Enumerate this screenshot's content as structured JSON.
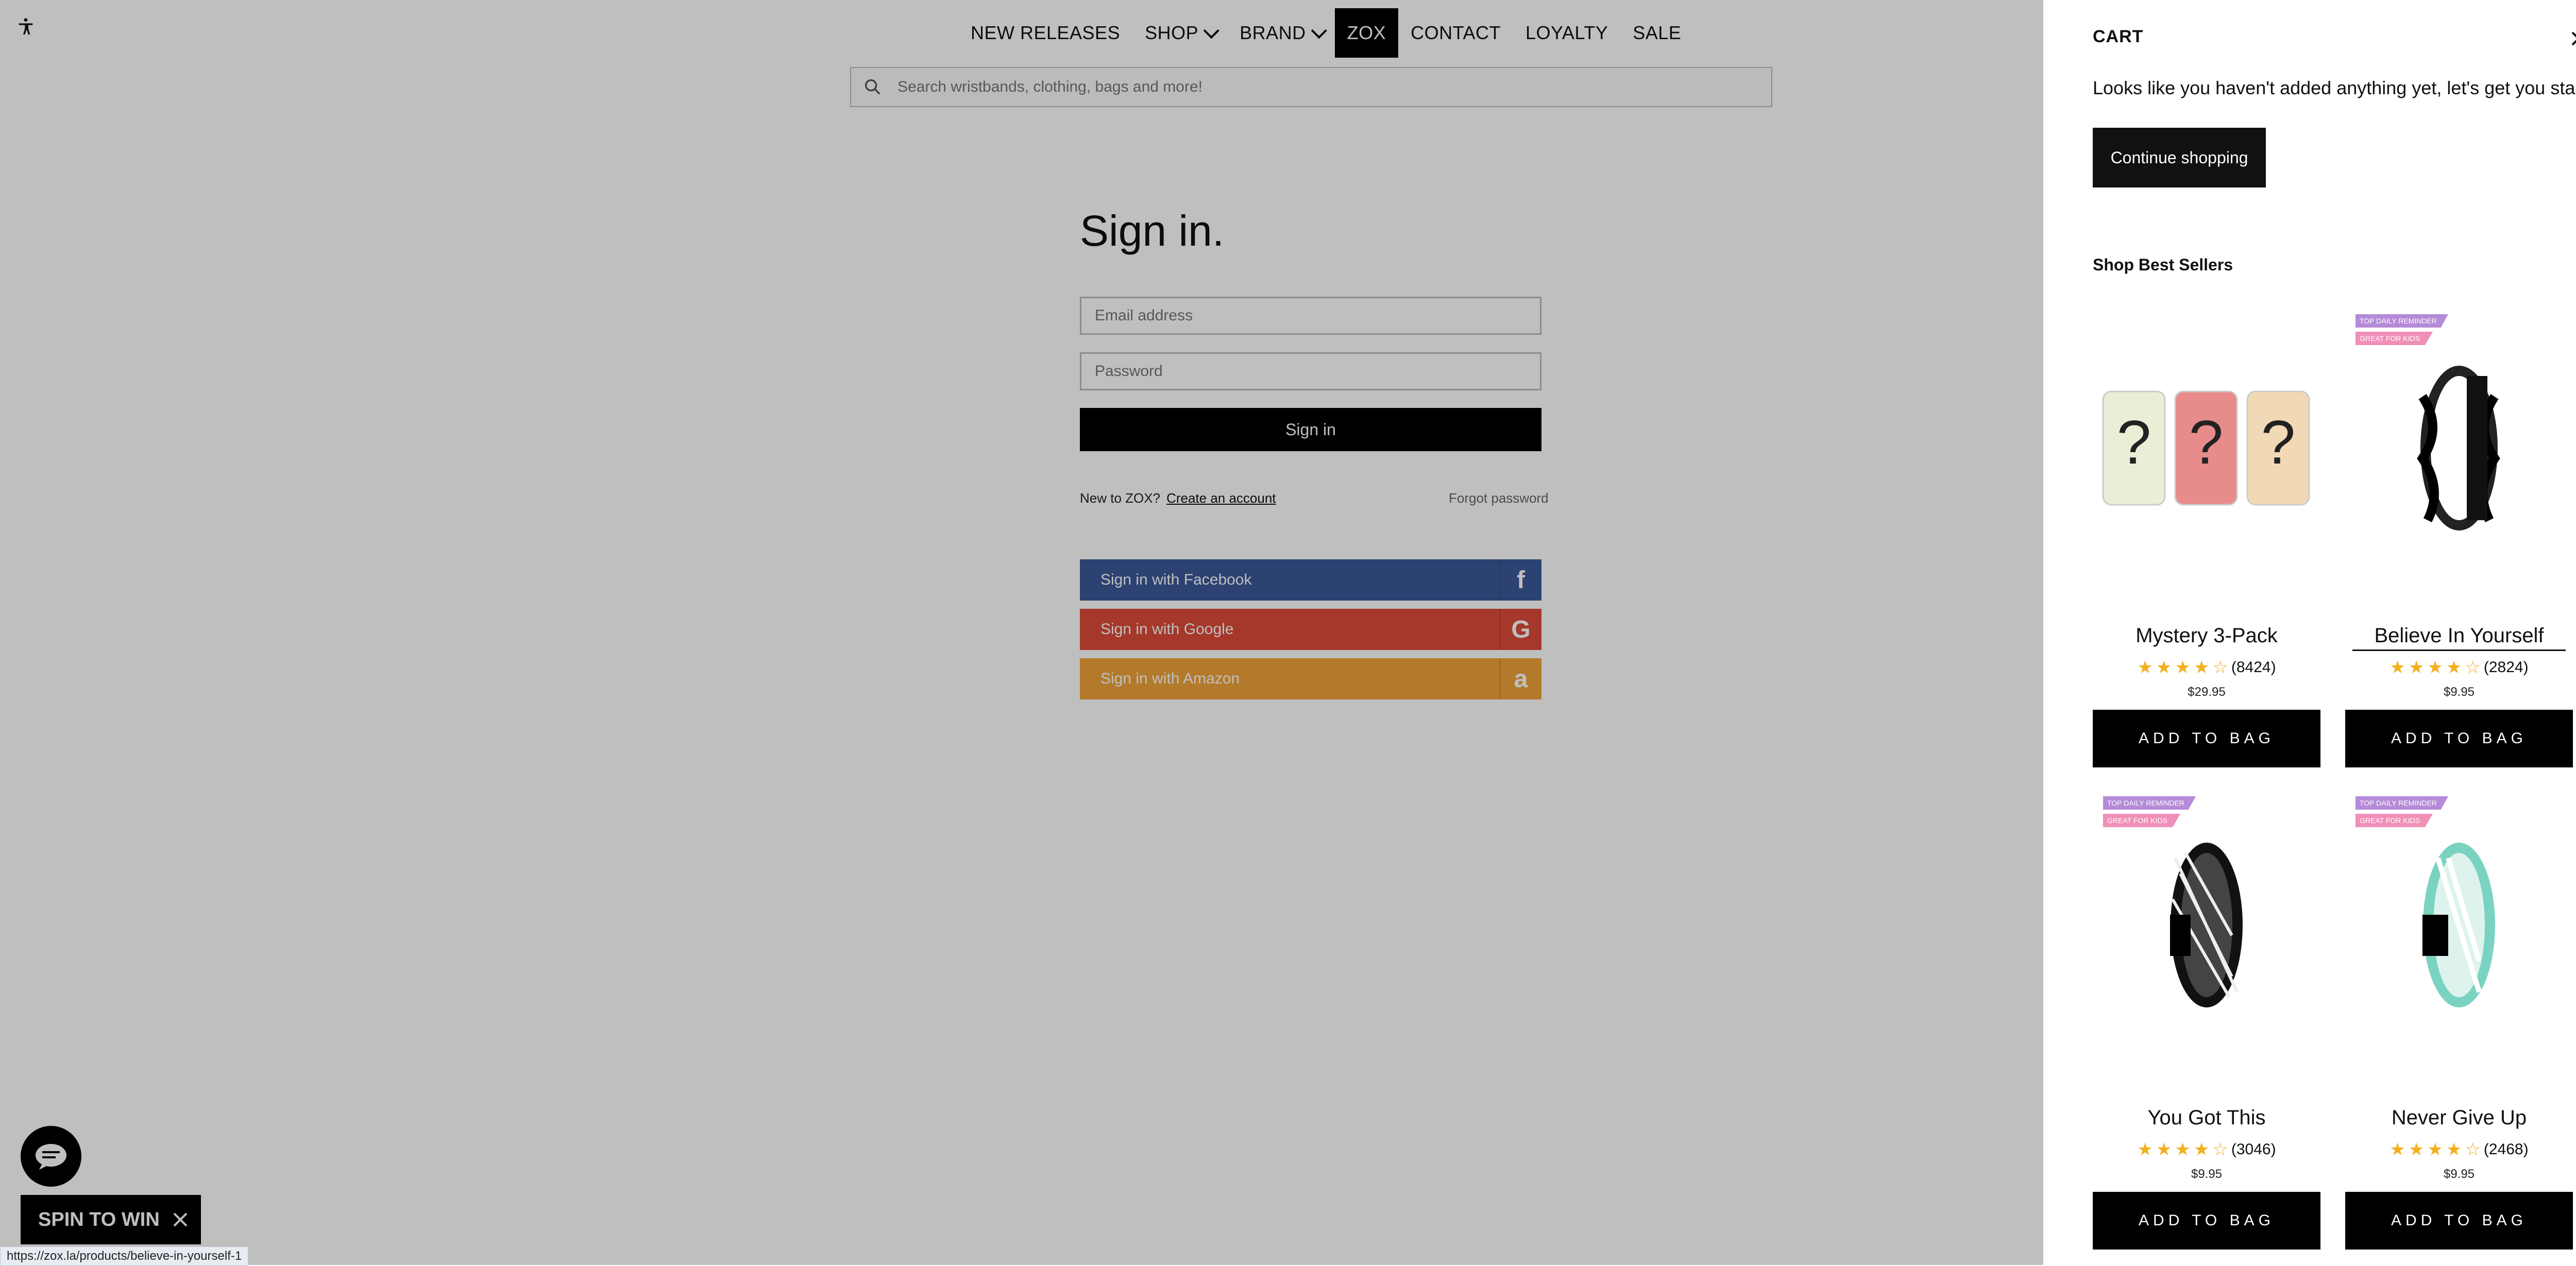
{
  "nav": {
    "items": [
      {
        "label": "NEW RELEASES"
      },
      {
        "label": "SHOP",
        "dropdown": true
      },
      {
        "label": "BRAND",
        "dropdown": true
      },
      {
        "label": "ZOX",
        "active": true
      },
      {
        "label": "CONTACT"
      },
      {
        "label": "LOYALTY"
      },
      {
        "label": "SALE"
      }
    ]
  },
  "search": {
    "placeholder": "Search wristbands, clothing, bags and more!"
  },
  "signin": {
    "title": "Sign in.",
    "email_placeholder": "Email address",
    "password_placeholder": "Password",
    "button": "Sign in",
    "new_to": "New to ZOX?",
    "create_account": "Create an account",
    "forgot": "Forgot password",
    "facebook": "Sign in with Facebook",
    "google": "Sign in with Google",
    "amazon": "Sign in with Amazon"
  },
  "spin": {
    "label": "SPIN TO WIN"
  },
  "status_url": "https://zox.la/products/believe-in-yourself-1",
  "cart": {
    "title": "CART",
    "empty_message": "Looks like you haven't added anything yet, let's get you started!",
    "continue_label": "Continue shopping",
    "best_sellers": "Shop Best Sellers",
    "products": [
      {
        "name": "Mystery 3-Pack",
        "reviews": "(8424)",
        "price": "$29.95",
        "add": "ADD TO BAG"
      },
      {
        "name": "Believe In Yourself",
        "reviews": "(2824)",
        "price": "$9.95",
        "add": "ADD TO BAG",
        "badge1": "TOP DAILY REMINDER",
        "badge2": "GREAT FOR KIDS"
      },
      {
        "name": "You Got This",
        "reviews": "(3046)",
        "price": "$9.95",
        "add": "ADD TO BAG",
        "badge1": "TOP DAILY REMINDER",
        "badge2": "GREAT FOR KIDS"
      },
      {
        "name": "Never Give Up",
        "reviews": "(2468)",
        "price": "$9.95",
        "add": "ADD TO BAG",
        "badge1": "TOP DAILY REMINDER",
        "badge2": "GREAT FOR KIDS"
      }
    ]
  },
  "colors": {
    "facebook": "#3b5998",
    "google": "#dd4b39",
    "amazon": "#f0a33a",
    "star": "#f2b01e"
  }
}
